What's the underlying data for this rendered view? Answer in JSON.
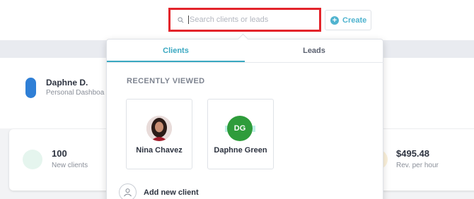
{
  "header": {
    "search": {
      "placeholder": "Search clients or leads",
      "value": ""
    },
    "create_label": "Create",
    "accent_color": "#4fb3cf",
    "highlight_color": "#e3242b"
  },
  "profile": {
    "name": "Daphne D.",
    "subtitle": "Personal Dashboa"
  },
  "stats": [
    {
      "value": "100",
      "label": "New clients"
    },
    {
      "value": "$495.48",
      "label": "Rev. per hour"
    }
  ],
  "dropdown": {
    "tabs": [
      {
        "label": "Clients",
        "active": true
      },
      {
        "label": "Leads",
        "active": false
      }
    ],
    "section_heading": "RECENTLY VIEWED",
    "recent_clients": [
      {
        "name": "Nina Chavez",
        "avatar": "photo"
      },
      {
        "name": "Daphne Green",
        "initials": "DG",
        "avatar_color": "#2e9c3b"
      }
    ],
    "add_new_label": "Add new client"
  }
}
